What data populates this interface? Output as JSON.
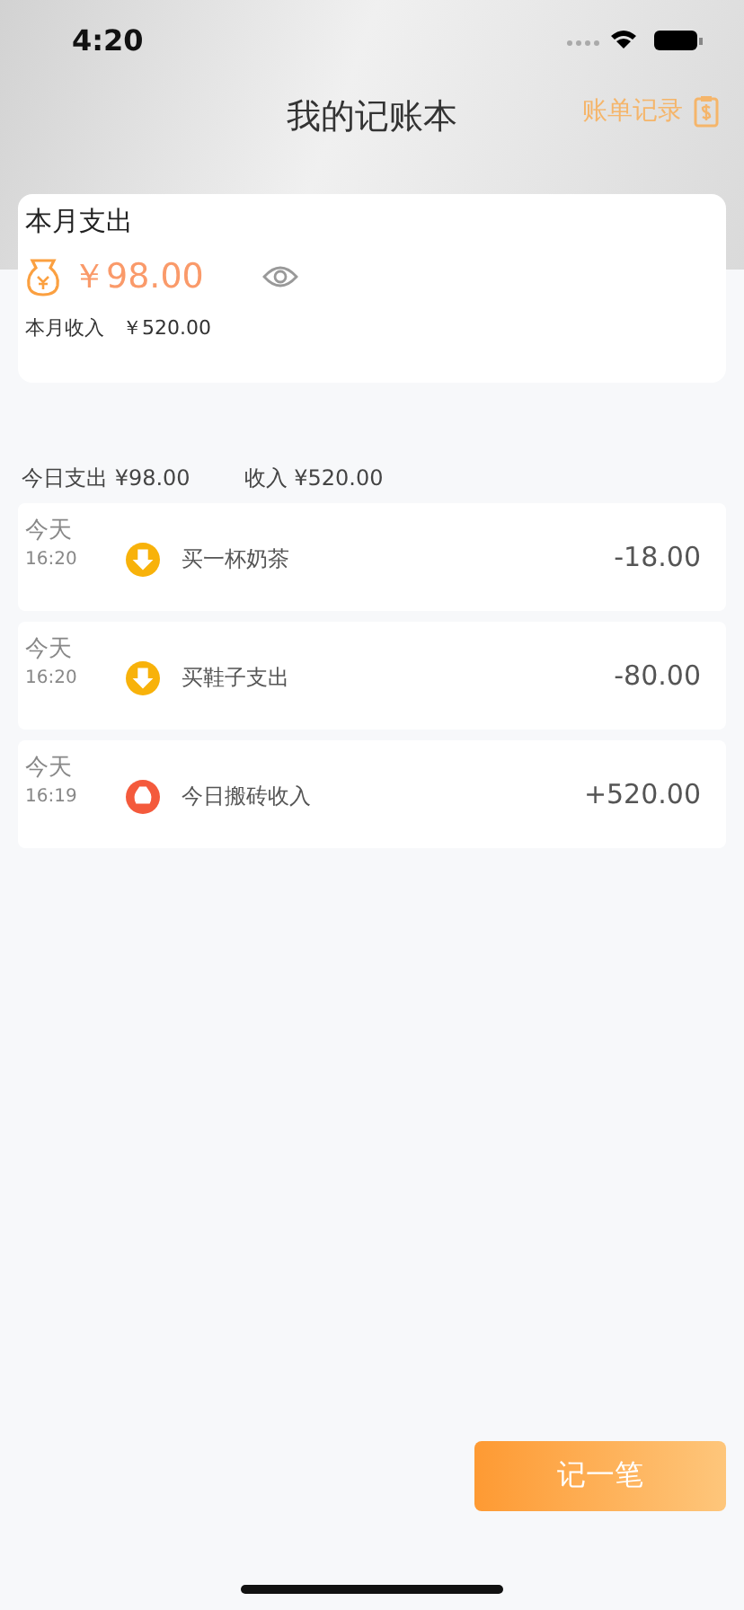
{
  "status_bar": {
    "time": "4:20"
  },
  "header": {
    "title": "我的记账本",
    "link": "账单记录"
  },
  "month_card": {
    "title": "本月支出",
    "amount": "￥98.00",
    "income_label": "本月收入",
    "income": "￥520.00"
  },
  "summary": {
    "expense": "今日支出 ¥98.00",
    "income": "收入 ¥520.00"
  },
  "transactions": [
    {
      "day": "今天",
      "time": "16:20",
      "kind": "expense",
      "name": "买一杯奶茶",
      "amount": "-18.00"
    },
    {
      "day": "今天",
      "time": "16:20",
      "kind": "expense",
      "name": "买鞋子支出",
      "amount": "-80.00"
    },
    {
      "day": "今天",
      "time": "16:19",
      "kind": "income",
      "name": "今日搬砖收入",
      "amount": "+520.00"
    }
  ],
  "add_button": "记一笔"
}
